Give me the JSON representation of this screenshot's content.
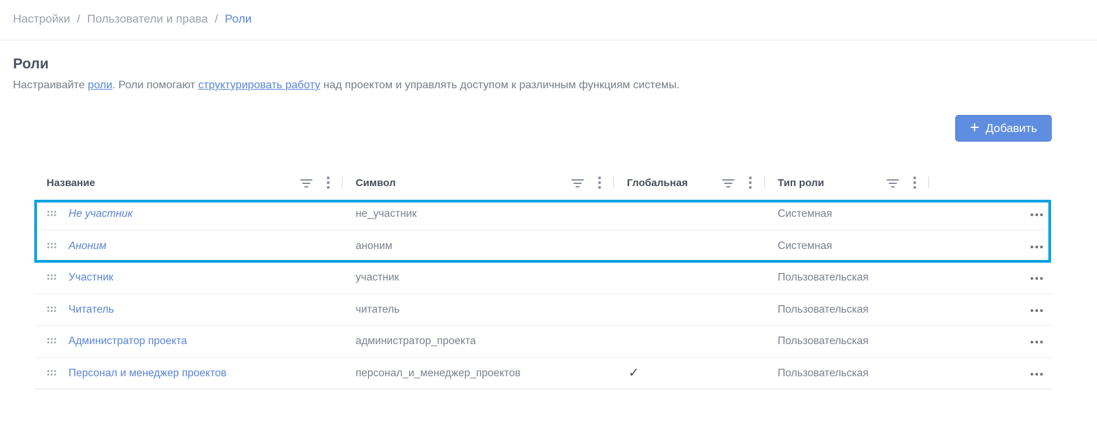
{
  "breadcrumb": {
    "items": [
      "Настройки",
      "Пользователи и права",
      "Роли"
    ],
    "separator": "/"
  },
  "page": {
    "title": "Роли",
    "description_parts": {
      "p1": "Настраивайте ",
      "link1": "роли",
      "p2": ". Роли помогают ",
      "link2": "структурировать работу",
      "p3": " над проектом и управлять доступом к различным функциям системы."
    }
  },
  "toolbar": {
    "add_label": "Добавить",
    "add_icon": "plus-icon"
  },
  "table": {
    "columns": [
      "Название",
      "Символ",
      "Глобальная",
      "Тип роли"
    ],
    "rows": [
      {
        "name": "Не участник",
        "symbol": "не_участник",
        "global": "",
        "type": "Системная"
      },
      {
        "name": "Аноним",
        "symbol": "аноним",
        "global": "",
        "type": "Системная"
      },
      {
        "name": "Участник",
        "symbol": "участник",
        "global": "",
        "type": "Пользовательская"
      },
      {
        "name": "Читатель",
        "symbol": "читатель",
        "global": "",
        "type": "Пользовательская"
      },
      {
        "name": "Администратор проекта",
        "symbol": "администратор_проекта",
        "global": "",
        "type": "Пользовательская"
      },
      {
        "name": "Персонал и менеджер проектов",
        "symbol": "персонал_и_менеджер_проектов",
        "global": "✓",
        "type": "Пользовательская"
      }
    ]
  },
  "colors": {
    "accent": "#5b84d6",
    "button": "#5f8ee0",
    "highlight": "#0aa3e0"
  }
}
